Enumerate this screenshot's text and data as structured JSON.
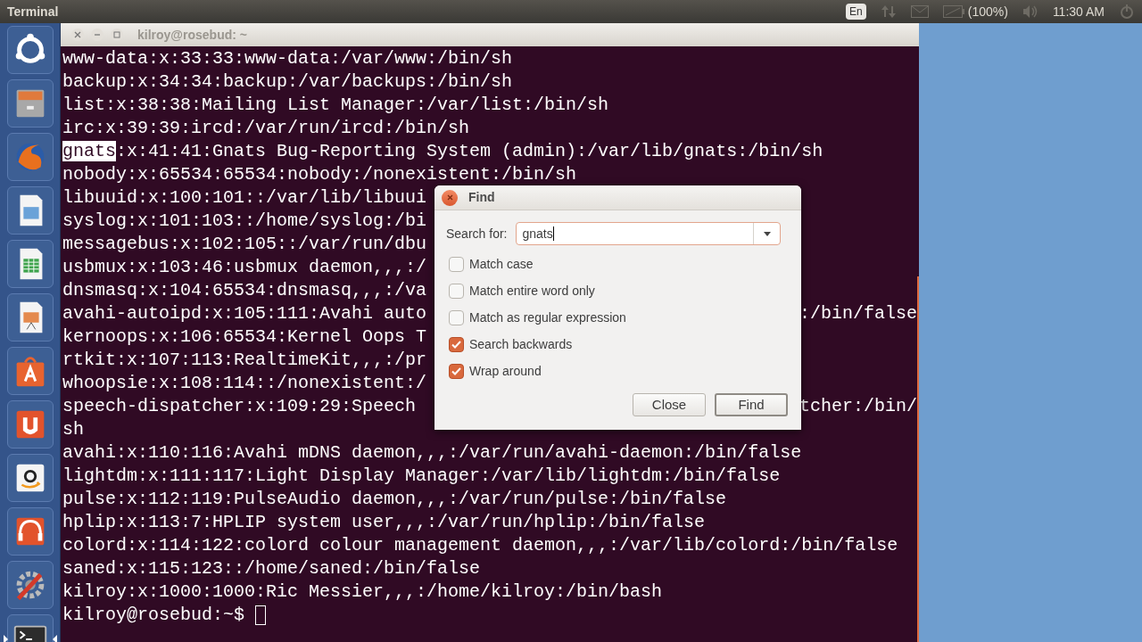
{
  "top_panel": {
    "app_title": "Terminal",
    "keyboard_layout": "En",
    "battery": "(100%)",
    "clock": "11:30 AM"
  },
  "launcher": {
    "items": [
      {
        "kind": "dash",
        "active": false
      },
      {
        "kind": "files",
        "active": false
      },
      {
        "kind": "browser",
        "active": false
      },
      {
        "kind": "draw",
        "active": false
      },
      {
        "kind": "spreadsheet",
        "active": false
      },
      {
        "kind": "presentation",
        "active": false
      },
      {
        "kind": "store",
        "active": false
      },
      {
        "kind": "course",
        "active": false
      },
      {
        "kind": "shop",
        "active": false
      },
      {
        "kind": "audio",
        "active": false
      },
      {
        "kind": "settings",
        "active": false
      },
      {
        "kind": "terminal",
        "active": true
      }
    ]
  },
  "terminal": {
    "title": "kilroy@rosebud: ~",
    "lines": [
      {
        "text": "www-data:x:33:33:www-data:/var/www:/bin/sh"
      },
      {
        "text": "backup:x:34:34:backup:/var/backups:/bin/sh"
      },
      {
        "text": "list:x:38:38:Mailing List Manager:/var/list:/bin/sh"
      },
      {
        "text": "irc:x:39:39:ircd:/var/run/ircd:/bin/sh"
      },
      {
        "segments": [
          {
            "text": "gnats",
            "highlighted": true
          },
          {
            "text": ":x:41:41:Gnats Bug-Reporting System (admin):/var/lib/gnats:/bin/sh",
            "highlighted": false
          }
        ]
      },
      {
        "text": "nobody:x:65534:65534:nobody:/nonexistent:/bin/sh"
      },
      {
        "text": "libuuid:x:100:101::/var/lib/libuui"
      },
      {
        "text": "syslog:x:101:103::/home/syslog:/bi"
      },
      {
        "text": "messagebus:x:102:105::/var/run/dbu"
      },
      {
        "text": "usbmux:x:103:46:usbmux daemon,,,:/"
      },
      {
        "text": "dnsmasq:x:104:65534:dnsmasq,,,:/va"
      },
      {
        "text": "avahi-autoipd:x:105:111:Avahi auto",
        "right": ":/bin/false"
      },
      {
        "text": "kernoops:x:106:65534:Kernel Oops T"
      },
      {
        "text": "rtkit:x:107:113:RealtimeKit,,,:/pr"
      },
      {
        "text": "whoopsie:x:108:114::/nonexistent:/"
      },
      {
        "text": "speech-dispatcher:x:109:29:Speech",
        "right": "tcher:/bin/"
      },
      {
        "text": "sh"
      },
      {
        "text": "avahi:x:110:116:Avahi mDNS daemon,,,:/var/run/avahi-daemon:/bin/false"
      },
      {
        "text": "lightdm:x:111:117:Light Display Manager:/var/lib/lightdm:/bin/false"
      },
      {
        "text": "pulse:x:112:119:PulseAudio daemon,,,:/var/run/pulse:/bin/false"
      },
      {
        "text": "hplip:x:113:7:HPLIP system user,,,:/var/run/hplip:/bin/false"
      },
      {
        "text": "colord:x:114:122:colord colour management daemon,,,:/var/lib/colord:/bin/false"
      },
      {
        "text": "saned:x:115:123::/home/saned:/bin/false"
      },
      {
        "text": "kilroy:x:1000:1000:Ric Messier,,,:/home/kilroy:/bin/bash"
      }
    ],
    "prompt": "kilroy@rosebud:~$ "
  },
  "find_dialog": {
    "title": "Find",
    "search_label": "Search for:",
    "search_value": "gnats",
    "options": [
      {
        "label": "Match case",
        "checked": false
      },
      {
        "label": "Match entire word only",
        "checked": false
      },
      {
        "label": "Match as regular expression",
        "checked": false
      },
      {
        "label": "Search backwards",
        "checked": true
      },
      {
        "label": "Wrap around",
        "checked": true
      }
    ],
    "buttons": [
      {
        "label": "Close",
        "default": false
      },
      {
        "label": "Find",
        "default": true
      }
    ]
  }
}
